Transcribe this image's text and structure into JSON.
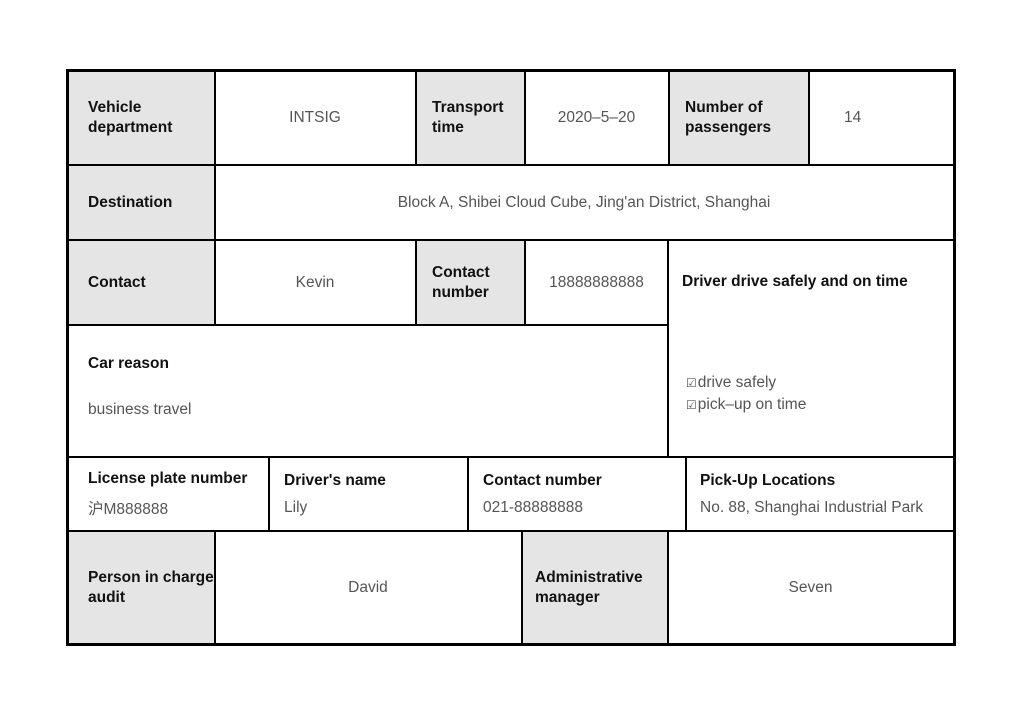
{
  "form": {
    "row1": {
      "vehicle_department_label": "Vehicle department",
      "vehicle_department_value": "INTSIG",
      "transport_time_label": "Transport time",
      "transport_time_value": "2020–5–20",
      "passengers_label": "Number of passengers",
      "passengers_value": "14"
    },
    "row2": {
      "destination_label": "Destination",
      "destination_value": "Block A, Shibei Cloud Cube, Jing'an District, Shanghai"
    },
    "row3": {
      "contact_label": "Contact",
      "contact_value": "Kevin",
      "contact_number_label": "Contact number",
      "contact_number_value": "18888888888"
    },
    "driver_requirements": {
      "title": "Driver drive safely and on time",
      "items": [
        {
          "checked": true,
          "icon": "☑",
          "label": "drive safely"
        },
        {
          "checked": true,
          "icon": "☑",
          "label": "pick–up on time"
        }
      ]
    },
    "car_reason": {
      "label": "Car reason",
      "value": "business travel"
    },
    "row5": {
      "license_plate_label": "License plate number",
      "license_plate_value": "沪M888888",
      "driver_name_label": "Driver's name",
      "driver_name_value": "Lily",
      "driver_contact_label": "Contact number",
      "driver_contact_value": "021-88888888",
      "pickup_label": "Pick-Up Locations",
      "pickup_value": "No. 88, Shanghai Industrial Park"
    },
    "row6": {
      "audit_label": "Person in charge audit",
      "audit_value": "David",
      "admin_label": "Administrative manager",
      "admin_value": "Seven"
    }
  }
}
